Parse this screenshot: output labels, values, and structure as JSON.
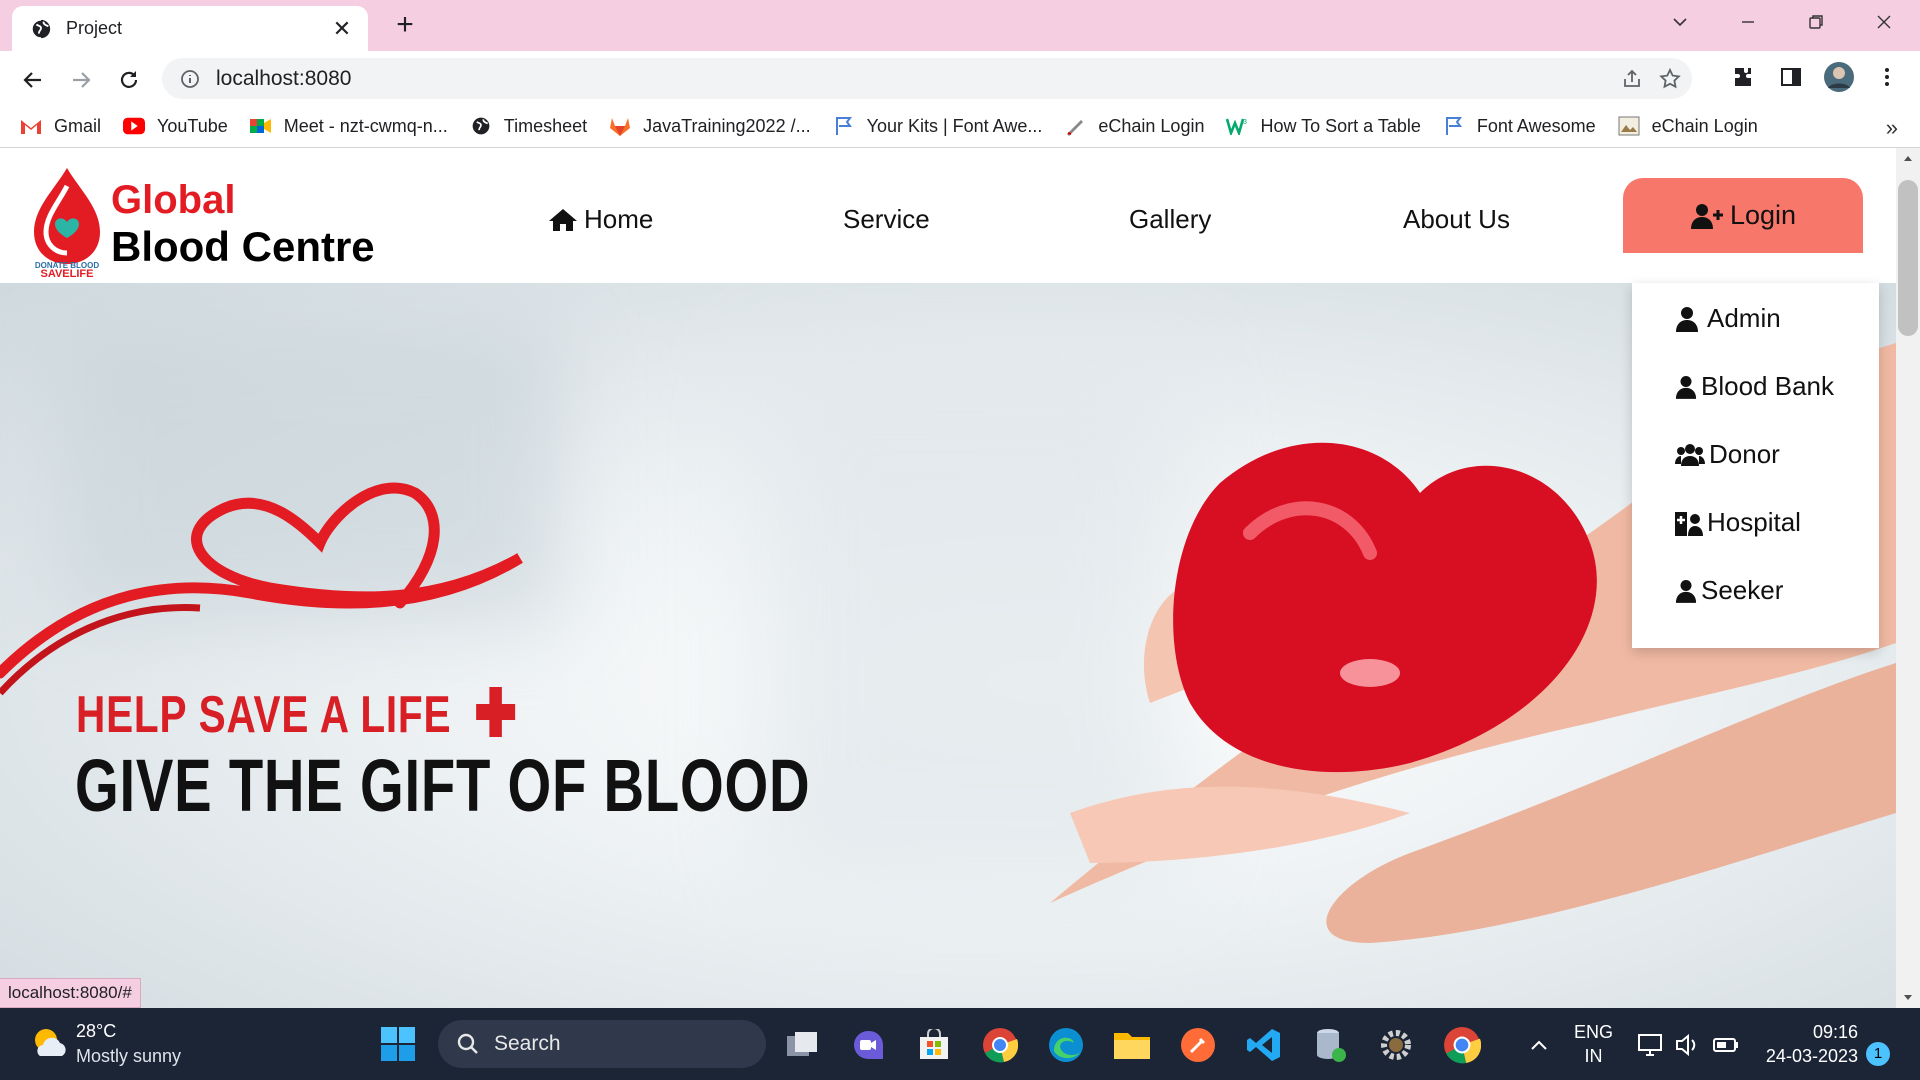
{
  "browser": {
    "tab_title": "Project",
    "url": "localhost:8080",
    "status_url": "localhost:8080/#"
  },
  "bookmarks": [
    {
      "label": "Gmail",
      "icon": "gmail-icon"
    },
    {
      "label": "YouTube",
      "icon": "youtube-icon"
    },
    {
      "label": "Meet - nzt-cwmq-n...",
      "icon": "meet-icon"
    },
    {
      "label": "Timesheet",
      "icon": "globe-icon"
    },
    {
      "label": "JavaTraining2022 /...",
      "icon": "gitlab-icon"
    },
    {
      "label": "Your Kits | Font Awe...",
      "icon": "flag-icon"
    },
    {
      "label": "eChain Login",
      "icon": "pen-icon"
    },
    {
      "label": "How To Sort a Table",
      "icon": "w3-icon"
    },
    {
      "label": "Font Awesome",
      "icon": "flag-icon"
    },
    {
      "label": "eChain Login",
      "icon": "image-icon"
    }
  ],
  "site": {
    "brand_line1": "Global",
    "brand_line2": "Blood Centre",
    "logo_text1": "DONATE BLOOD",
    "logo_text2": "SAVELIFE",
    "nav": [
      "Home",
      "Service",
      "Gallery",
      "About Us"
    ],
    "login_label": "Login",
    "dropdown": [
      "Admin",
      "Blood Bank",
      "Donor",
      "Hospital",
      "Seeker"
    ],
    "hero_line1": "HELP SAVE A LIFE",
    "hero_line2": "GIVE THE GIFT OF BLOOD"
  },
  "taskbar": {
    "temp": "28°C",
    "weather": "Mostly sunny",
    "search_placeholder": "Search",
    "lang1": "ENG",
    "lang2": "IN",
    "time": "09:16",
    "date": "24-03-2023",
    "notifications": "1"
  },
  "colors": {
    "tab_strip": "#f5cee1",
    "brand_red": "#e31b23",
    "login_button": "#f7776b",
    "taskbar": "#1c2536"
  }
}
